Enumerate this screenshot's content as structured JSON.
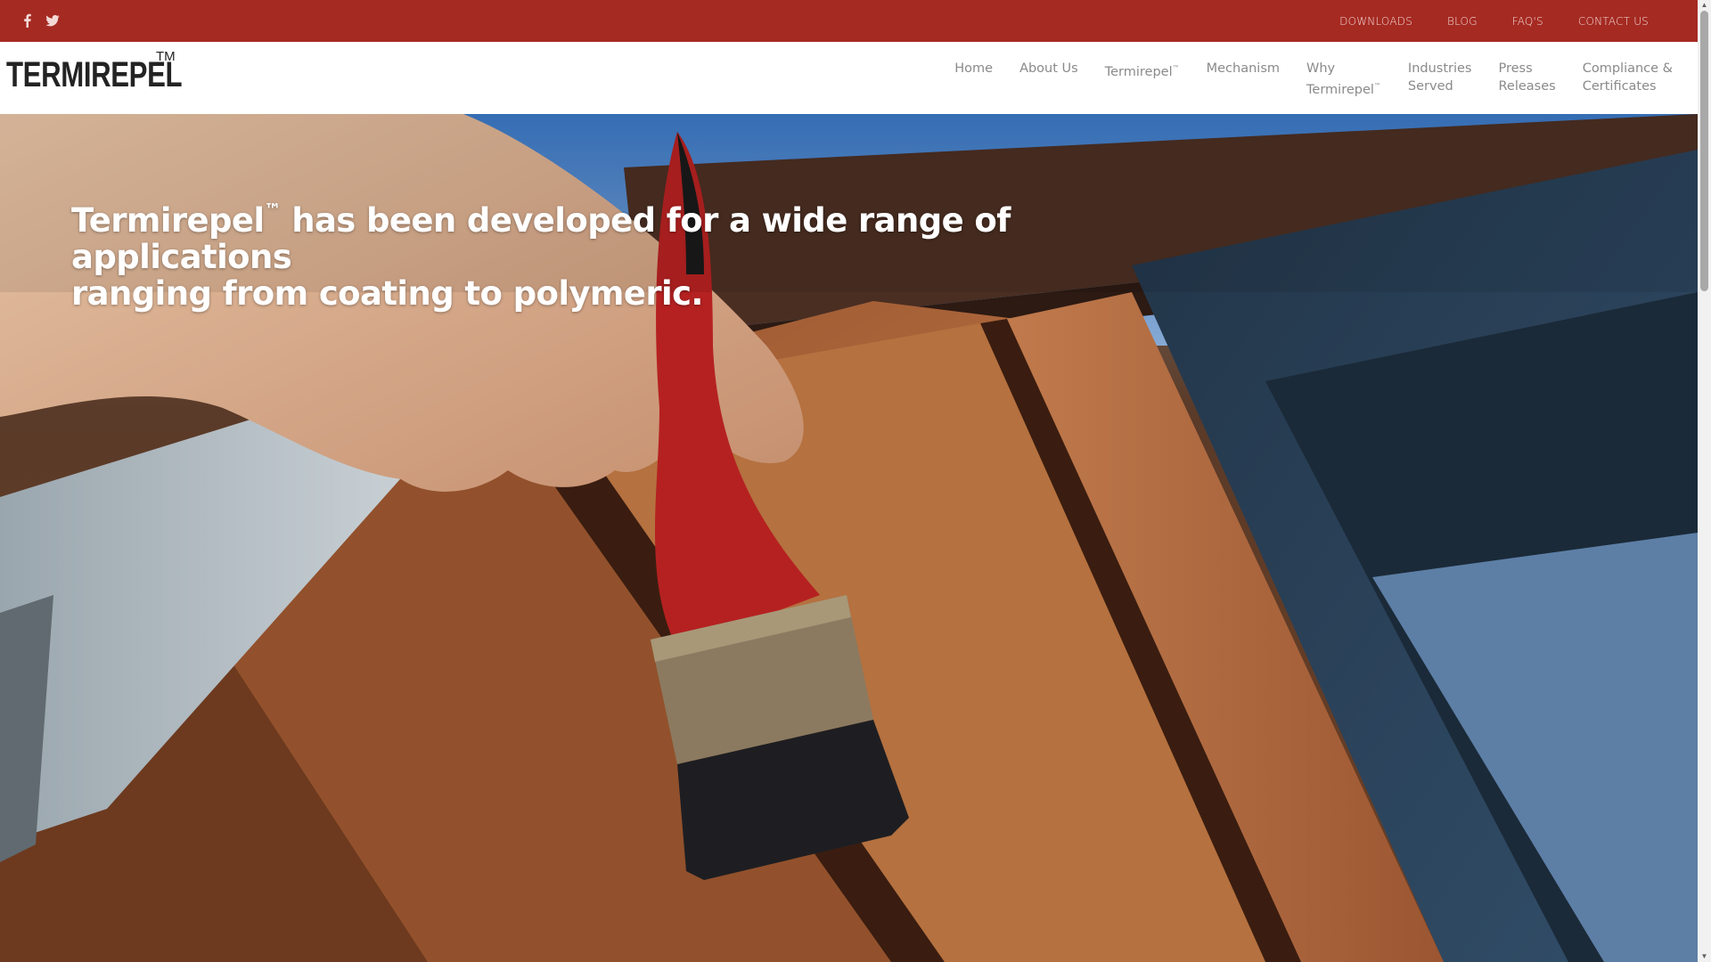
{
  "topbar": {
    "social": [
      {
        "name": "facebook-icon"
      },
      {
        "name": "twitter-icon"
      }
    ],
    "links": [
      "DOWNLOADS",
      "BLOG",
      "FAQ'S",
      "CONTACT US"
    ],
    "bg_color": "#a52a22"
  },
  "header": {
    "logo_text": "TERMIREPEL",
    "logo_tm": "TM",
    "nav": {
      "home": "Home",
      "about": "About Us",
      "termirepel": "Termirepel",
      "tm": "™",
      "mechanism": "Mechanism",
      "why_line1": "Why",
      "why_line2": "Termirepel",
      "industries_line1": "Industries",
      "industries_line2": "Served",
      "press_line1": "Press",
      "press_line2": "Releases",
      "compliance_line1": "Compliance &",
      "compliance_line2": "Certificates"
    }
  },
  "hero": {
    "title_part1": "Termirepel",
    "title_tm": "™",
    "title_part2": " has been developed for a wide range of applications",
    "title_line2": "ranging from coating to polymeric."
  }
}
